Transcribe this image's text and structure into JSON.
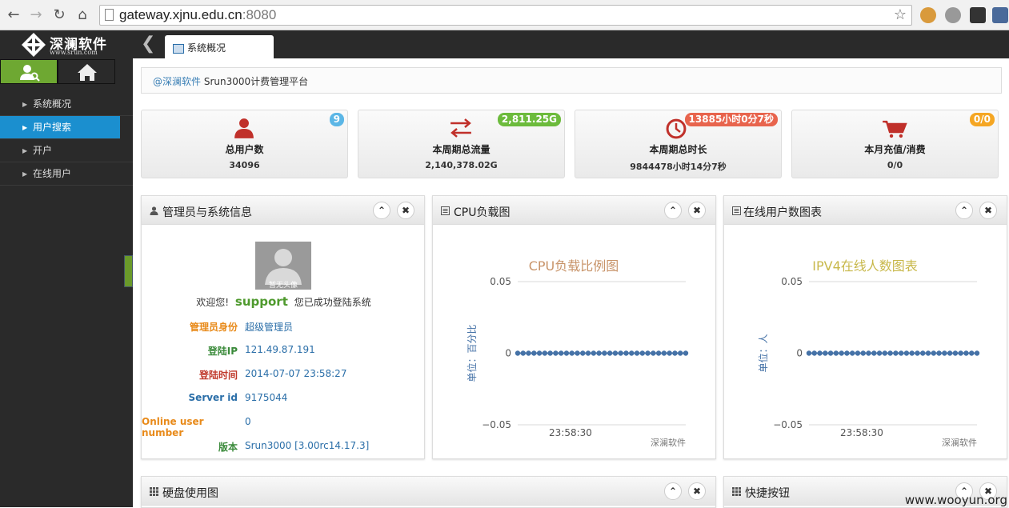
{
  "browser": {
    "url_host": "gateway.xjnu.edu.cn",
    "url_port": ":8080"
  },
  "sidebar": {
    "brand_cn": "深澜软件",
    "brand_url": "www.srun.com",
    "items": [
      {
        "label": "系统概况"
      },
      {
        "label": "用户搜索"
      },
      {
        "label": "开户"
      },
      {
        "label": "在线用户"
      }
    ]
  },
  "tab": {
    "label": "系统概况"
  },
  "breadcrumb": {
    "brand": "@深澜软件",
    "text": " Srun3000计费管理平台"
  },
  "stats": [
    {
      "label": "总用户数",
      "value": "34096",
      "badge": "9",
      "badge_color": "#5bb6e6"
    },
    {
      "label": "本周期总流量",
      "value": "2,140,378.02G",
      "badge": "2,811.25G",
      "badge_color": "#6cbb3c"
    },
    {
      "label": "本周期总时长",
      "value": "9844478小时14分7秒",
      "badge": "13885小时0分7秒",
      "badge_color": "#e8644d"
    },
    {
      "label": "本月充值/消费",
      "value": "0/0",
      "badge": "0/0",
      "badge_color": "#f5a623"
    }
  ],
  "admin_panel": {
    "title": "管理员与系统信息",
    "avatar_caption": "暂无头像",
    "welcome_prefix": "欢迎您!",
    "username": "support",
    "welcome_suffix": "您已成功登陆系统",
    "rows": [
      {
        "key": "管理员身份",
        "value": "超级管理员"
      },
      {
        "key": "登陆IP",
        "value": "121.49.87.191"
      },
      {
        "key": "登陆时间",
        "value": "2014-07-07 23:58:27"
      },
      {
        "key": "Server id",
        "value": "9175044"
      },
      {
        "key": "Online user number",
        "value": "0"
      },
      {
        "key": "版本",
        "value": "Srun3000 [3.00rc14.17.3]"
      }
    ]
  },
  "cpu_panel": {
    "title": "CPU负载图"
  },
  "online_panel": {
    "title": "在线用户数图表"
  },
  "disk_panel": {
    "title": "硬盘使用图"
  },
  "shortcut_panel": {
    "title": "快捷按钮"
  },
  "chart_data": [
    {
      "type": "line",
      "title": "CPU负载比例图",
      "title_color": "#c8946a",
      "ylabel": "单位：百分比",
      "x": [
        "23:58:30"
      ],
      "xtick_labels": [
        "23:58:30"
      ],
      "yticks": [
        "0.05",
        "0",
        "−0.05"
      ],
      "ylim": [
        -0.05,
        0.05
      ],
      "credit": "深澜软件",
      "series": [
        {
          "values": [
            0,
            0,
            0,
            0,
            0,
            0,
            0,
            0,
            0,
            0,
            0,
            0,
            0,
            0,
            0,
            0,
            0,
            0,
            0,
            0,
            0,
            0,
            0,
            0,
            0,
            0,
            0,
            0,
            0,
            0,
            0,
            0
          ],
          "color": "#4572a7"
        }
      ]
    },
    {
      "type": "line",
      "title": "IPV4在线人数图表",
      "title_color": "#c8b84a",
      "ylabel": "单位：人",
      "x": [
        "23:58:30"
      ],
      "xtick_labels": [
        "23:58:30"
      ],
      "yticks": [
        "0.05",
        "0",
        "−0.05"
      ],
      "ylim": [
        -0.05,
        0.05
      ],
      "credit": "深澜软件",
      "series": [
        {
          "values": [
            0,
            0,
            0,
            0,
            0,
            0,
            0,
            0,
            0,
            0,
            0,
            0,
            0,
            0,
            0,
            0,
            0,
            0,
            0,
            0,
            0,
            0,
            0,
            0,
            0,
            0,
            0,
            0,
            0,
            0,
            0,
            0
          ],
          "color": "#4572a7"
        }
      ]
    }
  ],
  "watermark": "www.wooyun.org"
}
